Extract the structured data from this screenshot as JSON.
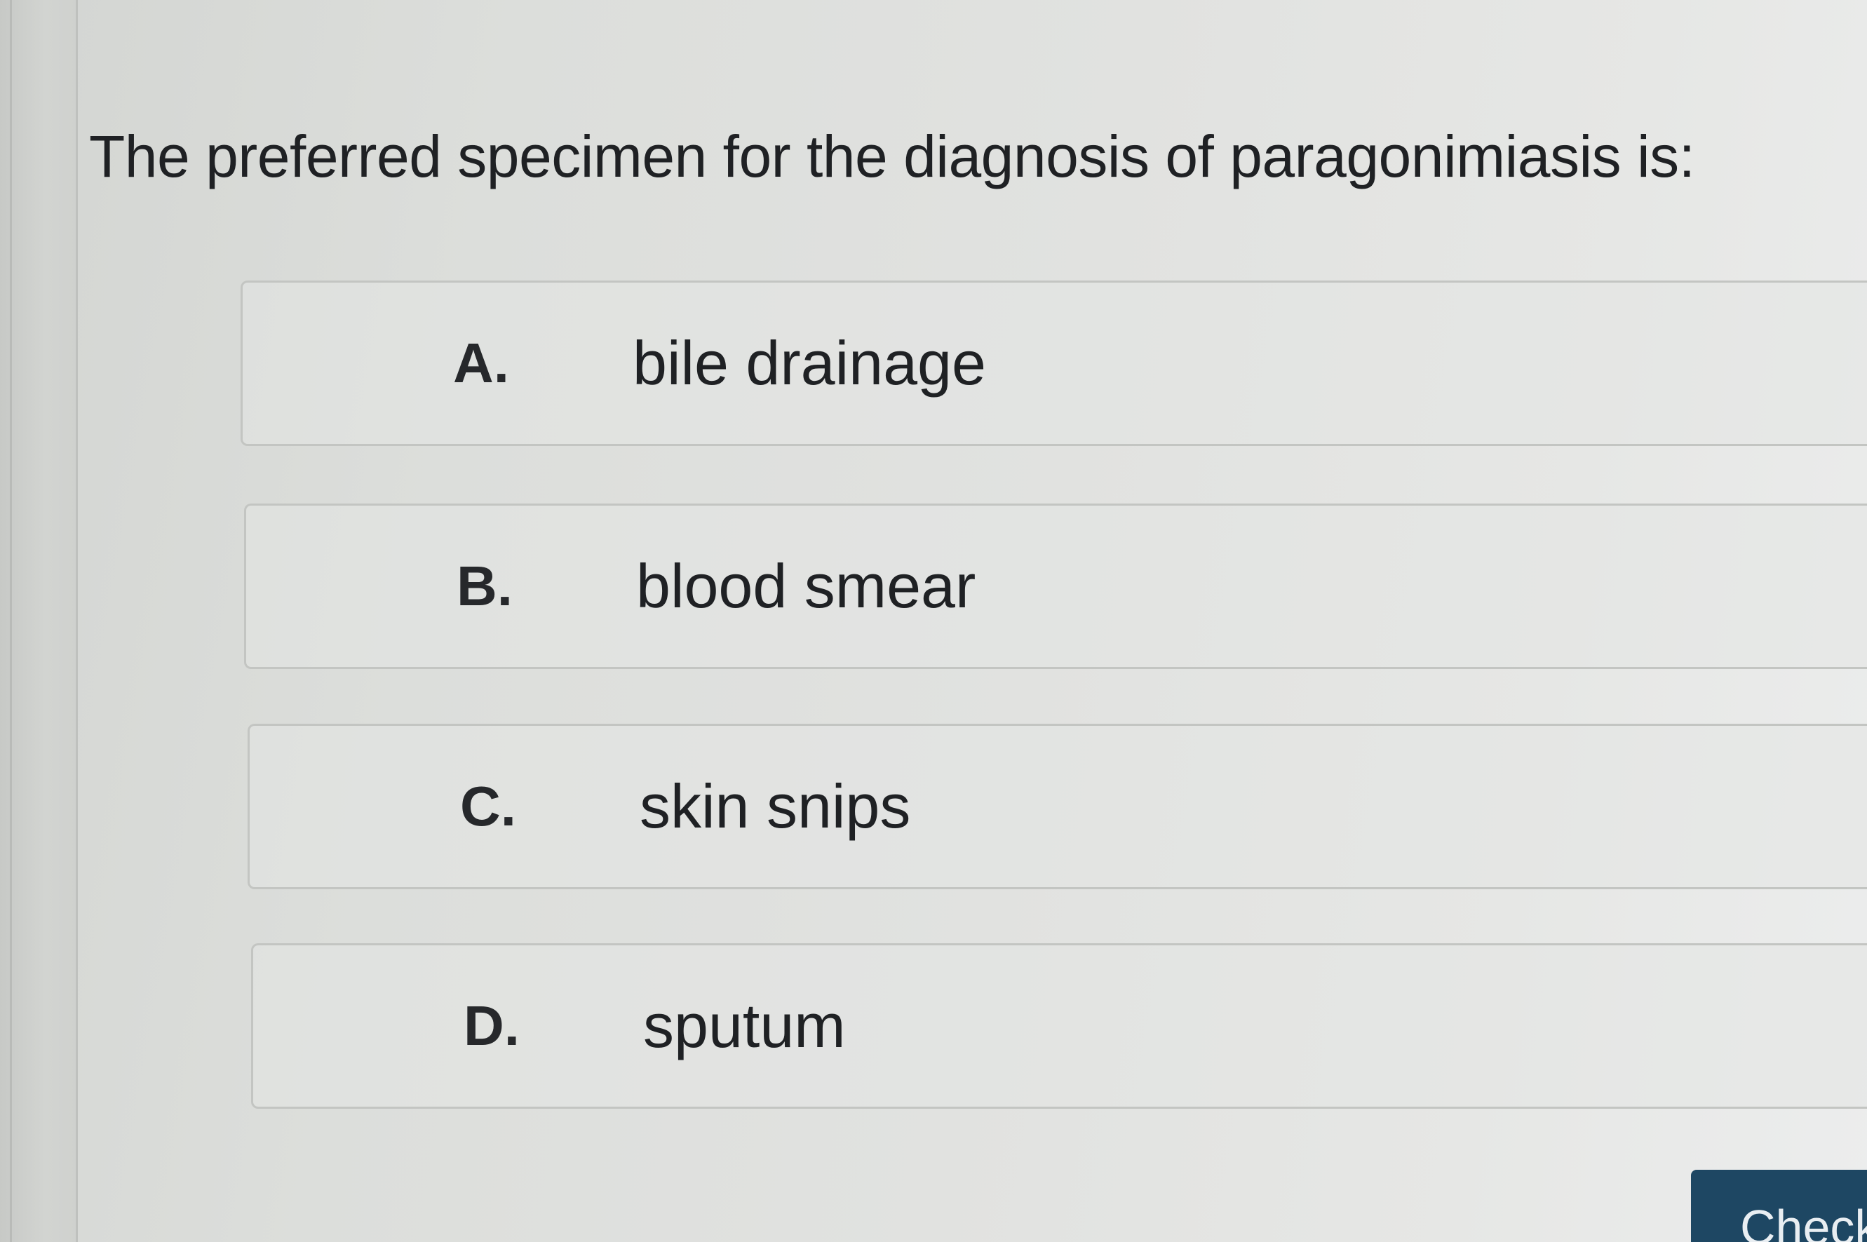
{
  "question": {
    "text": "The preferred specimen for the diagnosis of paragonimiasis is:"
  },
  "options": [
    {
      "letter": "A.",
      "text": "bile drainage"
    },
    {
      "letter": "B.",
      "text": "blood smear"
    },
    {
      "letter": "C.",
      "text": "skin snips"
    },
    {
      "letter": "D.",
      "text": "sputum"
    }
  ],
  "actions": {
    "check_label": "Check"
  },
  "colors": {
    "button_background": "#1e4763",
    "text": "#1f2124"
  }
}
